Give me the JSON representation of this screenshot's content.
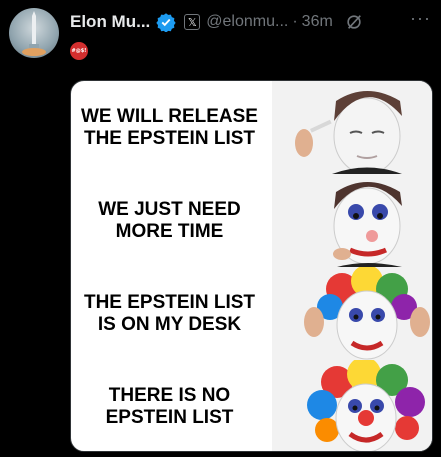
{
  "post": {
    "display_name": "Elon Mu...",
    "handle": "@elonmu...",
    "separator": "·",
    "time": "36m",
    "more": "···",
    "platform_badge": "𝕏",
    "verified_icon": "verified-badge-icon",
    "emoji_icon": "angry-face-icon"
  },
  "meme": {
    "panels": [
      {
        "caption": "WE WILL RELEASE THE EPSTEIN LIST"
      },
      {
        "caption": "WE JUST NEED MORE TIME"
      },
      {
        "caption": "THE EPSTEIN LIST IS ON MY DESK"
      },
      {
        "caption": "THERE IS NO EPSTEIN LIST"
      }
    ]
  },
  "colors": {
    "background": "#000000",
    "verified_blue": "#1d9bf0",
    "muted": "#71767b"
  }
}
